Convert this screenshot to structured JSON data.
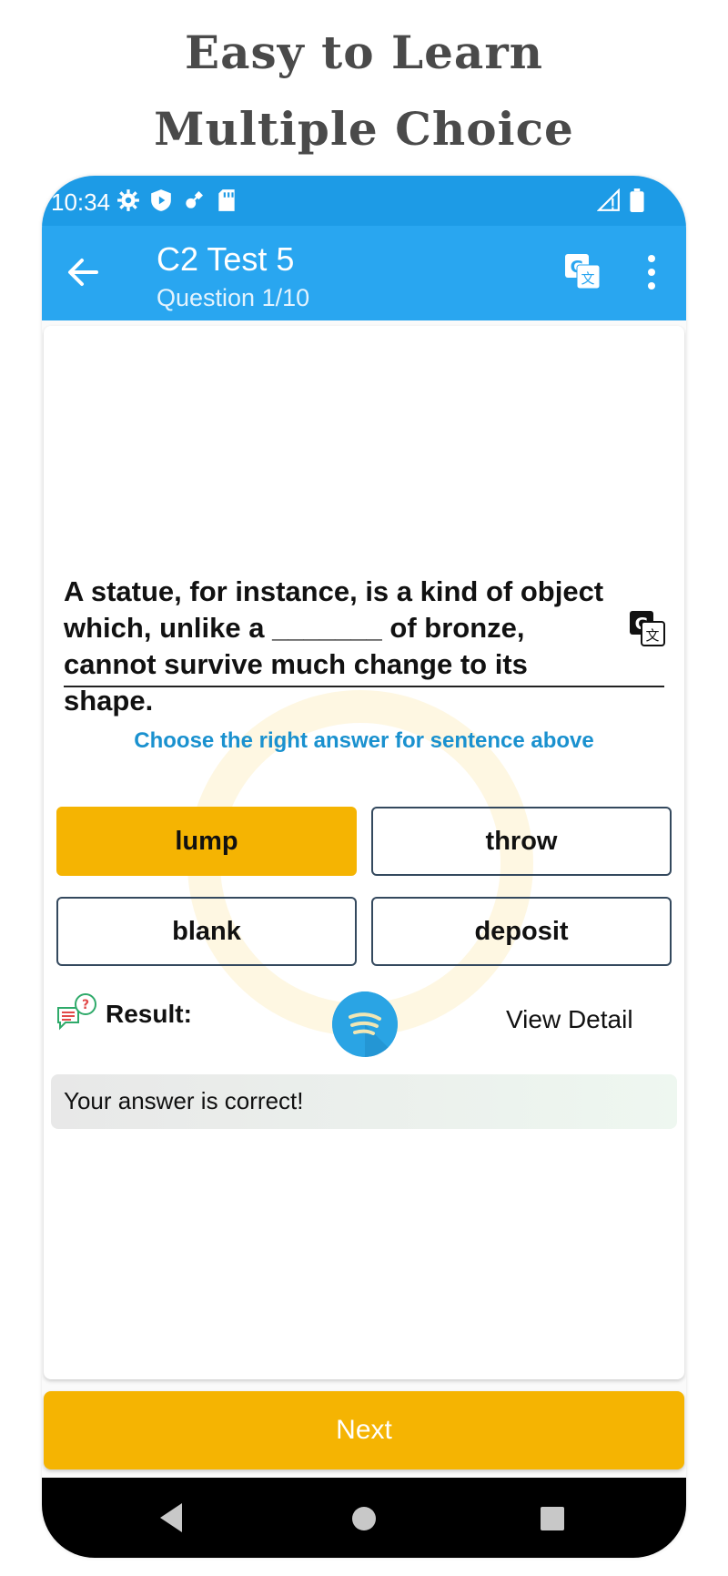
{
  "promo": {
    "line1": "Easy to Learn",
    "line2": "Multiple Choice"
  },
  "status_bar": {
    "time": "10:34",
    "icons": [
      "gear-icon",
      "shield-play-icon",
      "satellite-icon",
      "sd-card-icon",
      "signal-icon",
      "battery-icon"
    ]
  },
  "app_bar": {
    "title": "C2 Test 5",
    "subtitle": "Question 1/10",
    "color": "#29a6f0"
  },
  "question": {
    "text": "A statue, for instance, is a kind of object which, unlike a _______ of bronze, cannot survive much change to its shape.",
    "instruction": "Choose the right answer for sentence above"
  },
  "answers": [
    {
      "label": "lump",
      "selected": true
    },
    {
      "label": "throw",
      "selected": false
    },
    {
      "label": "blank",
      "selected": false
    },
    {
      "label": "deposit",
      "selected": false
    }
  ],
  "result": {
    "label": "Result:",
    "view_detail": "View Detail",
    "message": "Your answer is correct!"
  },
  "next_button": {
    "label": "Next",
    "color": "#f5b402"
  }
}
